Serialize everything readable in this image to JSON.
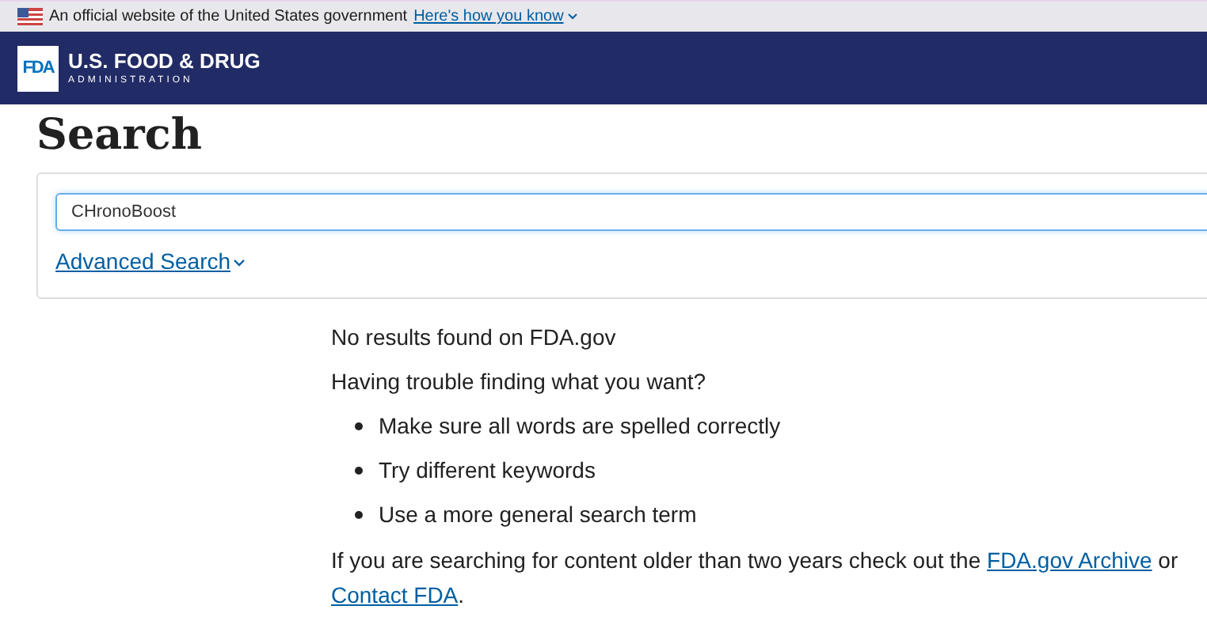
{
  "gov_banner": {
    "text": "An official website of the United States government",
    "link": "Here's how you know"
  },
  "header": {
    "logo": "FDA",
    "title": "U.S. FOOD & DRUG",
    "subtitle": "ADMINISTRATION"
  },
  "page_title": "Search",
  "search": {
    "value": "CHronoBoost",
    "advanced_link": "Advanced Search"
  },
  "results": {
    "message": "No results found on FDA.gov",
    "help_heading": "Having trouble finding what you want?",
    "tips": [
      "Make sure all words are spelled correctly",
      "Try different keywords",
      "Use a more general search term"
    ],
    "footer_text": "If you are searching for content older than two years check out the",
    "archive_link": "FDA.gov Archive",
    "or": "or",
    "contact_link": "Contact FDA",
    "period": "."
  }
}
